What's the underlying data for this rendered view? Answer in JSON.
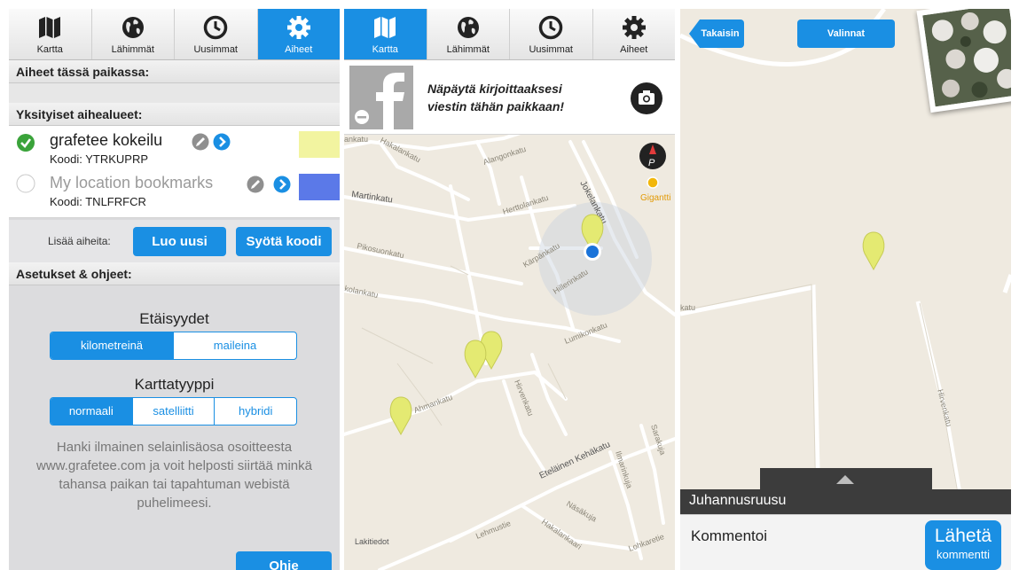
{
  "tabs": [
    {
      "label": "Kartta",
      "icon": "map-icon"
    },
    {
      "label": "Lähimmät",
      "icon": "globe-icon"
    },
    {
      "label": "Uusimmat",
      "icon": "clock-icon"
    },
    {
      "label": "Aiheet",
      "icon": "gear-icon"
    }
  ],
  "topics_screen": {
    "section_here": "Aiheet tässä paikassa:",
    "section_private": "Yksityiset aihealueet:",
    "topics": [
      {
        "name": "grafetee kokeilu",
        "code": "Koodi: YTRKUPRP",
        "selected": true,
        "color": "#f2f4a0"
      },
      {
        "name": "My location bookmarks",
        "code": "Koodi: TNLFRFCR",
        "selected": false,
        "color": "#5b79e8"
      }
    ],
    "add_label": "Lisää aiheita:",
    "create_button": "Luo uusi",
    "enter_code_button": "Syötä koodi",
    "section_settings": "Asetukset & ohjeet:",
    "distances_title": "Etäisyydet",
    "distance_options": [
      "kilometreinä",
      "maileina"
    ],
    "distance_selected": "kilometreinä",
    "maptype_title": "Karttatyyppi",
    "maptype_options": [
      "normaali",
      "satelliitti",
      "hybridi"
    ],
    "maptype_selected": "normaali",
    "info_text": "Hanki ilmainen selainlisäosa osoitteesta www.grafetee.com ja voit helposti siirtää minkä tahansa paikan tai tapahtuman webistä puhelimeesi.",
    "help_button": "Ohje"
  },
  "map_screen": {
    "post_prompt_line1": "Näpäytä kirjoittaaksesi",
    "post_prompt_line2": "viestin tähän paikkaan!",
    "streets": [
      "Alangonkatu",
      "Hakalankatu",
      "ankatu",
      "Martinkatu",
      "Jokelankatu",
      "Herttolankatu",
      "Kärpänkatu",
      "Pikosuonkatu",
      "kolankatu",
      "Hillerinkatu",
      "Lumikonkatu",
      "Ahmankatu",
      "Hirvenkatu",
      "Eteläinen Kehäkatu",
      "Ilmarinkuja",
      "Sarakuja",
      "Näsäkuja",
      "Lehmustie",
      "Hakalankaari",
      "Lohkaretie",
      "Lakitiedot"
    ],
    "poi_label": "Gigantti",
    "compass_label": "P"
  },
  "detail_screen": {
    "back_button": "Takaisin",
    "options_button": "Valinnat",
    "street_labels": [
      "katu",
      "Hirvenkatu"
    ],
    "place_name": "Juhannusruusu",
    "comment_placeholder": "Kommentoi",
    "send_button_line1": "Lähetä",
    "send_button_line2": "kommentti"
  },
  "colors": {
    "accent": "#1a8fe3",
    "pin": "#e4ea72",
    "map_bg": "#efeae0"
  }
}
